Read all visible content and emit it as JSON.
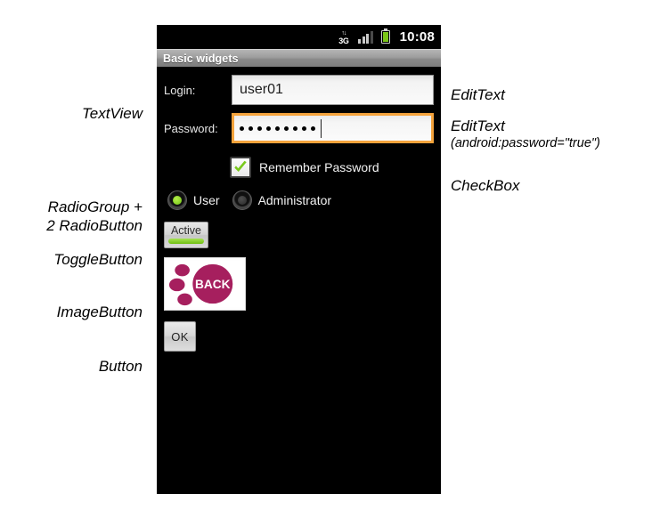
{
  "status_bar": {
    "network_label": "3G",
    "time": "10:08"
  },
  "title_bar": {
    "title": "Basic widgets"
  },
  "form": {
    "login": {
      "label": "Login:",
      "value": "user01"
    },
    "password": {
      "label": "Password:",
      "masked_value": "•••••••••",
      "dot_count": 9
    },
    "checkbox": {
      "label": "Remember Password",
      "checked": true
    },
    "radio_group": {
      "options": [
        {
          "label": "User",
          "selected": true
        },
        {
          "label": "Administrator",
          "selected": false
        }
      ]
    },
    "toggle_button": {
      "label": "Active",
      "state": "on"
    },
    "image_button": {
      "image_label": "BACK"
    },
    "ok_button": {
      "label": "OK"
    }
  },
  "annotations": {
    "left": [
      {
        "text": "TextView"
      },
      {
        "text": "RadioGroup +"
      },
      {
        "text": "2 RadioButton"
      },
      {
        "text": "ToggleButton"
      },
      {
        "text": "ImageButton"
      },
      {
        "text": "Button"
      }
    ],
    "right": [
      {
        "text": "EditText"
      },
      {
        "text": "EditText",
        "sub": "(android:password=\"true\")"
      },
      {
        "text": "CheckBox"
      }
    ]
  },
  "colors": {
    "screen_background": "#000000",
    "focus_orange": "#f4a33c",
    "accent_green": "#7bc518",
    "image_magenta": "#a61f5e",
    "title_bar_gray": "#9d9d9d"
  }
}
